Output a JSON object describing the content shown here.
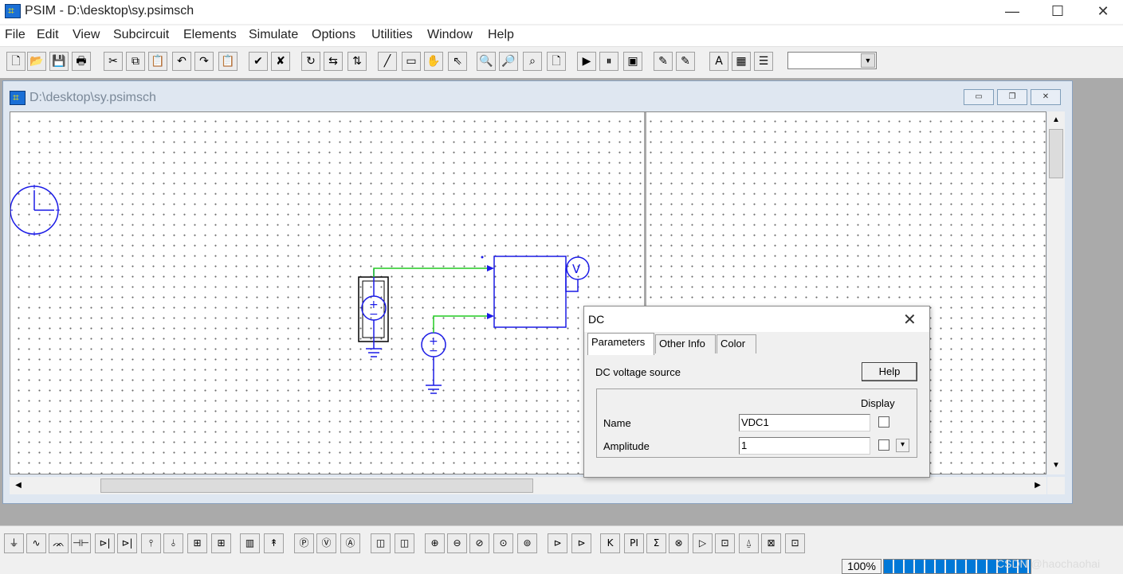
{
  "window": {
    "title": "PSIM - D:\\desktop\\sy.psimsch",
    "minimize_glyph": "—",
    "maximize_glyph": "☐",
    "close_glyph": "✕"
  },
  "menu": [
    "File",
    "Edit",
    "View",
    "Subcircuit",
    "Elements",
    "Simulate",
    "Options",
    "Utilities",
    "Window",
    "Help"
  ],
  "toolbar": {
    "buttons": [
      {
        "name": "new-icon",
        "glyph": "🗋"
      },
      {
        "name": "open-icon",
        "glyph": "📂"
      },
      {
        "name": "save-icon",
        "glyph": "💾"
      },
      {
        "name": "print-icon",
        "glyph": "🖶"
      },
      {
        "name": "cut-icon",
        "glyph": "✂"
      },
      {
        "name": "copy-icon",
        "glyph": "⧉"
      },
      {
        "name": "paste-icon",
        "glyph": "📋"
      },
      {
        "name": "undo-icon",
        "glyph": "↶"
      },
      {
        "name": "redo-icon",
        "glyph": "↷"
      },
      {
        "name": "clipboard-icon",
        "glyph": "📋"
      },
      {
        "name": "check-icon",
        "glyph": "✔"
      },
      {
        "name": "cancel-icon",
        "glyph": "✘"
      },
      {
        "name": "rotate-icon",
        "glyph": "↻"
      },
      {
        "name": "flip-lr-icon",
        "glyph": "⇆"
      },
      {
        "name": "flip-tb-icon",
        "glyph": "⇅"
      },
      {
        "name": "wire-icon",
        "glyph": "╱"
      },
      {
        "name": "label-icon",
        "glyph": "▭"
      },
      {
        "name": "pan-icon",
        "glyph": "✋"
      },
      {
        "name": "select-icon",
        "glyph": "⇖"
      },
      {
        "name": "zoom-in-icon",
        "glyph": "🔍"
      },
      {
        "name": "zoom-out-icon",
        "glyph": "🔎"
      },
      {
        "name": "zoom-fit-icon",
        "glyph": "⌕"
      },
      {
        "name": "page-icon",
        "glyph": "🗋"
      },
      {
        "name": "run-simulation-icon",
        "glyph": "▶"
      },
      {
        "name": "pause-simulation-icon",
        "glyph": "⏸"
      },
      {
        "name": "simview-icon",
        "glyph": "▣"
      },
      {
        "name": "probe-icon",
        "glyph": "✎"
      },
      {
        "name": "probe-multi-icon",
        "glyph": "✎"
      },
      {
        "name": "text-icon",
        "glyph": "A"
      },
      {
        "name": "parameter-icon",
        "glyph": "▦"
      },
      {
        "name": "list-icon",
        "glyph": "☰"
      }
    ],
    "combo_value": "",
    "combo_arrow": "▼"
  },
  "child_window": {
    "title": "D:\\desktop\\sy.psimsch",
    "min_glyph": "▭",
    "restore_glyph": "❐",
    "close_glyph": "✕"
  },
  "circuit": {
    "voltmeter_label": "V",
    "plus_sign": "+",
    "minus_sign": "−"
  },
  "scroll": {
    "up": "▲",
    "down": "▼",
    "left": "◀",
    "right": "▶"
  },
  "dialog": {
    "title": "DC",
    "close_glyph": "✕",
    "tabs": [
      "Parameters",
      "Other Info",
      "Color"
    ],
    "description": "DC voltage source",
    "help_label": "Help",
    "display_header": "Display",
    "params": [
      {
        "label": "Name",
        "value": "VDC1"
      },
      {
        "label": "Amplitude",
        "value": "1"
      }
    ],
    "dropdown_glyph": "▾"
  },
  "element_bar": [
    {
      "name": "ground-icon",
      "glyph": "⏚"
    },
    {
      "name": "resistor-icon",
      "glyph": "∿"
    },
    {
      "name": "inductor-icon",
      "glyph": "ᨏ"
    },
    {
      "name": "capacitor-icon",
      "glyph": "⊣⊢"
    },
    {
      "name": "diode-icon",
      "glyph": "⊳|"
    },
    {
      "name": "thyristor-icon",
      "glyph": "⊳|"
    },
    {
      "name": "igbt-icon",
      "glyph": "⫯"
    },
    {
      "name": "mosfet-icon",
      "glyph": "⫰"
    },
    {
      "name": "switch-a-icon",
      "glyph": "⊞"
    },
    {
      "name": "switch-b-icon",
      "glyph": "⊞"
    },
    {
      "name": "transformer-icon",
      "glyph": "▥"
    },
    {
      "name": "source-arrow-icon",
      "glyph": "↟"
    },
    {
      "name": "meter-a-icon",
      "glyph": "Ⓟ"
    },
    {
      "name": "voltmeter-icon",
      "glyph": "Ⓥ"
    },
    {
      "name": "ammeter-icon",
      "glyph": "Ⓐ"
    },
    {
      "name": "scope-icon",
      "glyph": "◫"
    },
    {
      "name": "scope-b-icon",
      "glyph": "◫"
    },
    {
      "name": "dc-source-icon",
      "glyph": "⊕"
    },
    {
      "name": "ac-source-icon",
      "glyph": "⊖"
    },
    {
      "name": "square-source-icon",
      "glyph": "⊘"
    },
    {
      "name": "step-source-icon",
      "glyph": "⊙"
    },
    {
      "name": "triangle-source-icon",
      "glyph": "⊚"
    },
    {
      "name": "comparator-icon",
      "glyph": "⊳"
    },
    {
      "name": "limiter-icon",
      "glyph": "⊳"
    },
    {
      "name": "gain-icon",
      "glyph": "K"
    },
    {
      "name": "pi-controller-icon",
      "glyph": "PI"
    },
    {
      "name": "summer-icon",
      "glyph": "Σ"
    },
    {
      "name": "multiplier-icon",
      "glyph": "⊗"
    },
    {
      "name": "op-amp-icon",
      "glyph": "▷"
    },
    {
      "name": "transfer-fn-icon",
      "glyph": "⊡"
    },
    {
      "name": "probe-tip-icon",
      "glyph": "⍙"
    },
    {
      "name": "block-a-icon",
      "glyph": "⊠"
    },
    {
      "name": "block-b-icon",
      "glyph": "⊡"
    }
  ],
  "status": {
    "zoom": "100%",
    "watermark": "CSDN @haochaohai"
  }
}
